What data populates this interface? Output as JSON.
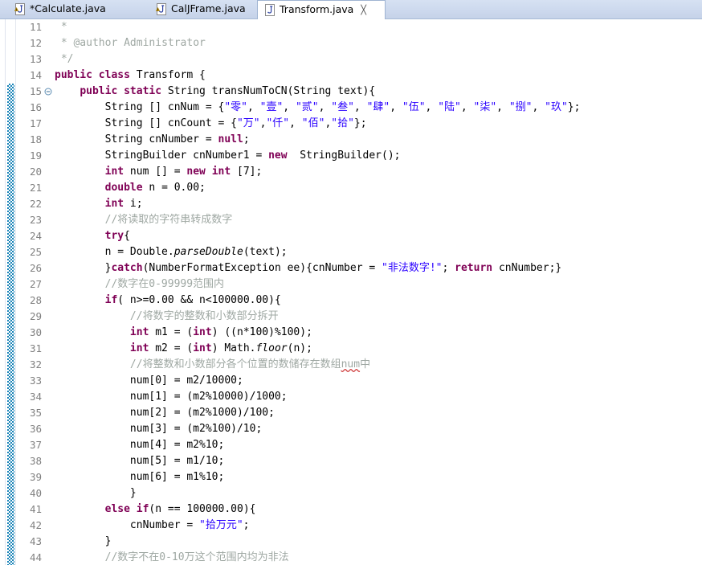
{
  "window": {
    "application": "Eclipse IDE Java Editor",
    "accent_color": "#cdd9ee",
    "change_bar_color": "#1a84b8"
  },
  "tabbar": {
    "tabs": [
      {
        "label": "*Calculate.java",
        "icon": "java-file-warning-icon",
        "active": false,
        "dirty": true,
        "closable": false
      },
      {
        "label": "CalJFrame.java",
        "icon": "java-file-warning-icon",
        "active": false,
        "dirty": false,
        "closable": false
      },
      {
        "label": "Transform.java",
        "icon": "java-file-icon",
        "active": true,
        "dirty": false,
        "closable": true
      }
    ],
    "close_glyph": "╳"
  },
  "gutter": {
    "fold_marker_line": 15,
    "fold_marker_name": "fold-collapse-icon",
    "change_bar_start_line": 15,
    "first_line": 11,
    "last_line": 44,
    "line_numbers": [
      11,
      12,
      13,
      14,
      15,
      16,
      17,
      18,
      19,
      20,
      21,
      22,
      23,
      24,
      25,
      26,
      27,
      28,
      29,
      30,
      31,
      32,
      33,
      34,
      35,
      36,
      37,
      38,
      39,
      40,
      41,
      42,
      43,
      44
    ]
  },
  "code": {
    "language": "Java",
    "file_name": "Transform.java",
    "lines": [
      {
        "n": 11,
        "tokens": [
          {
            "t": " * ",
            "c": "cmt"
          }
        ]
      },
      {
        "n": 12,
        "tokens": [
          {
            "t": " * ",
            "c": "cmt"
          },
          {
            "t": "@author",
            "c": "cmt"
          },
          {
            "t": " Administrator",
            "c": "cmt"
          }
        ]
      },
      {
        "n": 13,
        "tokens": [
          {
            "t": " */",
            "c": "cmt"
          }
        ]
      },
      {
        "n": 14,
        "tokens": [
          {
            "t": "public class ",
            "c": "kw"
          },
          {
            "t": "Transform {",
            "c": "plain"
          }
        ]
      },
      {
        "n": 15,
        "tokens": [
          {
            "t": "    ",
            "c": "plain"
          },
          {
            "t": "public static ",
            "c": "kw"
          },
          {
            "t": "String transNumToCN(String text){",
            "c": "plain"
          }
        ]
      },
      {
        "n": 16,
        "tokens": [
          {
            "t": "        String [] cnNum = {",
            "c": "plain"
          },
          {
            "t": "\"零\"",
            "c": "str"
          },
          {
            "t": ", ",
            "c": "plain"
          },
          {
            "t": "\"壹\"",
            "c": "str"
          },
          {
            "t": ", ",
            "c": "plain"
          },
          {
            "t": "\"贰\"",
            "c": "str"
          },
          {
            "t": ", ",
            "c": "plain"
          },
          {
            "t": "\"叁\"",
            "c": "str"
          },
          {
            "t": ", ",
            "c": "plain"
          },
          {
            "t": "\"肆\"",
            "c": "str"
          },
          {
            "t": ", ",
            "c": "plain"
          },
          {
            "t": "\"伍\"",
            "c": "str"
          },
          {
            "t": ", ",
            "c": "plain"
          },
          {
            "t": "\"陆\"",
            "c": "str"
          },
          {
            "t": ", ",
            "c": "plain"
          },
          {
            "t": "\"柒\"",
            "c": "str"
          },
          {
            "t": ", ",
            "c": "plain"
          },
          {
            "t": "\"捌\"",
            "c": "str"
          },
          {
            "t": ", ",
            "c": "plain"
          },
          {
            "t": "\"玖\"",
            "c": "str"
          },
          {
            "t": "};",
            "c": "plain"
          }
        ]
      },
      {
        "n": 17,
        "tokens": [
          {
            "t": "        String [] cnCount = {",
            "c": "plain"
          },
          {
            "t": "\"万\"",
            "c": "str"
          },
          {
            "t": ",",
            "c": "plain"
          },
          {
            "t": "\"仟\"",
            "c": "str"
          },
          {
            "t": ", ",
            "c": "plain"
          },
          {
            "t": "\"佰\"",
            "c": "str"
          },
          {
            "t": ",",
            "c": "plain"
          },
          {
            "t": "\"拾\"",
            "c": "str"
          },
          {
            "t": "};",
            "c": "plain"
          }
        ]
      },
      {
        "n": 18,
        "tokens": [
          {
            "t": "        String cnNumber = ",
            "c": "plain"
          },
          {
            "t": "null",
            "c": "kw"
          },
          {
            "t": ";",
            "c": "plain"
          }
        ]
      },
      {
        "n": 19,
        "tokens": [
          {
            "t": "        StringBuilder cnNumber1 = ",
            "c": "plain"
          },
          {
            "t": "new",
            "c": "kw"
          },
          {
            "t": "  StringBuilder();",
            "c": "plain"
          }
        ]
      },
      {
        "n": 20,
        "tokens": [
          {
            "t": "        ",
            "c": "plain"
          },
          {
            "t": "int",
            "c": "kw"
          },
          {
            "t": " num [] = ",
            "c": "plain"
          },
          {
            "t": "new int",
            "c": "kw"
          },
          {
            "t": " [7];",
            "c": "plain"
          }
        ]
      },
      {
        "n": 21,
        "tokens": [
          {
            "t": "        ",
            "c": "plain"
          },
          {
            "t": "double",
            "c": "kw"
          },
          {
            "t": " n = 0.00;",
            "c": "plain"
          }
        ]
      },
      {
        "n": 22,
        "tokens": [
          {
            "t": "        ",
            "c": "plain"
          },
          {
            "t": "int",
            "c": "kw"
          },
          {
            "t": " i;",
            "c": "plain"
          }
        ]
      },
      {
        "n": 23,
        "tokens": [
          {
            "t": "        //将读取的字符串转成数字",
            "c": "cmt"
          }
        ]
      },
      {
        "n": 24,
        "tokens": [
          {
            "t": "        ",
            "c": "plain"
          },
          {
            "t": "try",
            "c": "kw"
          },
          {
            "t": "{",
            "c": "plain"
          }
        ]
      },
      {
        "n": 25,
        "tokens": [
          {
            "t": "        n = Double.",
            "c": "plain"
          },
          {
            "t": "parseDouble",
            "c": "stm"
          },
          {
            "t": "(text);",
            "c": "plain"
          }
        ]
      },
      {
        "n": 26,
        "tokens": [
          {
            "t": "        }",
            "c": "plain"
          },
          {
            "t": "catch",
            "c": "kw"
          },
          {
            "t": "(NumberFormatException ee){cnNumber = ",
            "c": "plain"
          },
          {
            "t": "\"非法数字!\"",
            "c": "str"
          },
          {
            "t": "; ",
            "c": "plain"
          },
          {
            "t": "return",
            "c": "kw"
          },
          {
            "t": " cnNumber;}",
            "c": "plain"
          }
        ]
      },
      {
        "n": 27,
        "tokens": [
          {
            "t": "        //数字在0-99999范围内",
            "c": "cmt"
          }
        ]
      },
      {
        "n": 28,
        "tokens": [
          {
            "t": "        ",
            "c": "plain"
          },
          {
            "t": "if",
            "c": "kw"
          },
          {
            "t": "( n>=0.00 && n<100000.00){",
            "c": "plain"
          }
        ]
      },
      {
        "n": 29,
        "tokens": [
          {
            "t": "            //将数字的整数和小数部分拆开",
            "c": "cmt"
          }
        ]
      },
      {
        "n": 30,
        "tokens": [
          {
            "t": "            ",
            "c": "plain"
          },
          {
            "t": "int",
            "c": "kw"
          },
          {
            "t": " m1 = (",
            "c": "plain"
          },
          {
            "t": "int",
            "c": "kw"
          },
          {
            "t": ") ((n*100)%100);",
            "c": "plain"
          }
        ]
      },
      {
        "n": 31,
        "tokens": [
          {
            "t": "            ",
            "c": "plain"
          },
          {
            "t": "int",
            "c": "kw"
          },
          {
            "t": " m2 = (",
            "c": "plain"
          },
          {
            "t": "int",
            "c": "kw"
          },
          {
            "t": ") Math.",
            "c": "plain"
          },
          {
            "t": "floor",
            "c": "stm"
          },
          {
            "t": "(n);",
            "c": "plain"
          }
        ]
      },
      {
        "n": 32,
        "tokens": [
          {
            "t": "            //将整数和小数部分各个位置的数储存在数组",
            "c": "cmt"
          },
          {
            "t": "num",
            "c": "cmt spell"
          },
          {
            "t": "中",
            "c": "cmt"
          }
        ]
      },
      {
        "n": 33,
        "tokens": [
          {
            "t": "            num[0] = m2/10000;",
            "c": "plain"
          }
        ]
      },
      {
        "n": 34,
        "tokens": [
          {
            "t": "            num[1] = (m2%10000)/1000;",
            "c": "plain"
          }
        ]
      },
      {
        "n": 35,
        "tokens": [
          {
            "t": "            num[2] = (m2%1000)/100;",
            "c": "plain"
          }
        ]
      },
      {
        "n": 36,
        "tokens": [
          {
            "t": "            num[3] = (m2%100)/10;",
            "c": "plain"
          }
        ]
      },
      {
        "n": 37,
        "tokens": [
          {
            "t": "            num[4] = m2%10;",
            "c": "plain"
          }
        ]
      },
      {
        "n": 38,
        "tokens": [
          {
            "t": "            num[5] = m1/10;",
            "c": "plain"
          }
        ]
      },
      {
        "n": 39,
        "tokens": [
          {
            "t": "            num[6] = m1%10;",
            "c": "plain"
          }
        ]
      },
      {
        "n": 40,
        "tokens": [
          {
            "t": "            }",
            "c": "plain"
          }
        ]
      },
      {
        "n": 41,
        "tokens": [
          {
            "t": "        ",
            "c": "plain"
          },
          {
            "t": "else if",
            "c": "kw"
          },
          {
            "t": "(n == 100000.00){",
            "c": "plain"
          }
        ]
      },
      {
        "n": 42,
        "tokens": [
          {
            "t": "            cnNumber = ",
            "c": "plain"
          },
          {
            "t": "\"拾万元\"",
            "c": "str"
          },
          {
            "t": ";",
            "c": "plain"
          }
        ]
      },
      {
        "n": 43,
        "tokens": [
          {
            "t": "        }",
            "c": "plain"
          }
        ]
      },
      {
        "n": 44,
        "tokens": [
          {
            "t": "        //数字不在0-10万这个范围内均为非法",
            "c": "cmt"
          }
        ]
      }
    ]
  }
}
